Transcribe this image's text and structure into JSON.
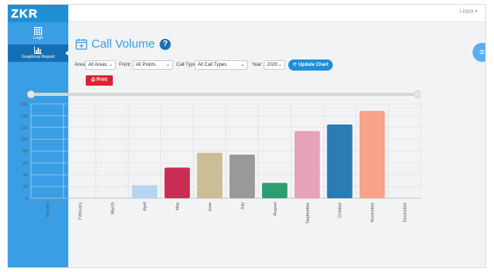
{
  "app": {
    "logo_text": "ZKR",
    "user_name": "Liqaa"
  },
  "sidebar": {
    "items": [
      {
        "label": "Logs",
        "icon": "table-icon",
        "active": false
      },
      {
        "label": "Graphical Report",
        "icon": "bar-chart-icon",
        "active": true
      }
    ]
  },
  "page": {
    "title": "Call Volume"
  },
  "filters": {
    "area_label": "Area:",
    "area_value": "All Areas",
    "point_label": "Point:",
    "point_value": "All Points",
    "call_type_label": "Call Type:",
    "call_type_value": "All Call Types",
    "year_label": "Year:",
    "year_value": "2020",
    "update_button": "Update Chart"
  },
  "print_button": "Print",
  "colors": {
    "accent": "#1f8fd6",
    "sidebar": "#3a9ee4",
    "sidebar_active": "#156fb4",
    "print": "#d9232f"
  },
  "chart_data": {
    "type": "bar",
    "categories": [
      "January",
      "February",
      "March",
      "April",
      "May",
      "June",
      "July",
      "August",
      "September",
      "October",
      "November",
      "December"
    ],
    "values": [
      0,
      0,
      0,
      22,
      52,
      77,
      74,
      26,
      114,
      125,
      148,
      0
    ],
    "colors": [
      "#cccccc",
      "#cccccc",
      "#cccccc",
      "#b5d4f2",
      "#cc2d55",
      "#cbbd96",
      "#999999",
      "#2e9e70",
      "#e6a3b7",
      "#2a7cb3",
      "#f7a48a",
      "#cccccc"
    ],
    "ylim": [
      0,
      160
    ],
    "yticks": [
      0,
      20,
      40,
      60,
      80,
      100,
      120,
      140,
      160
    ],
    "grid": true,
    "legend": "none"
  }
}
